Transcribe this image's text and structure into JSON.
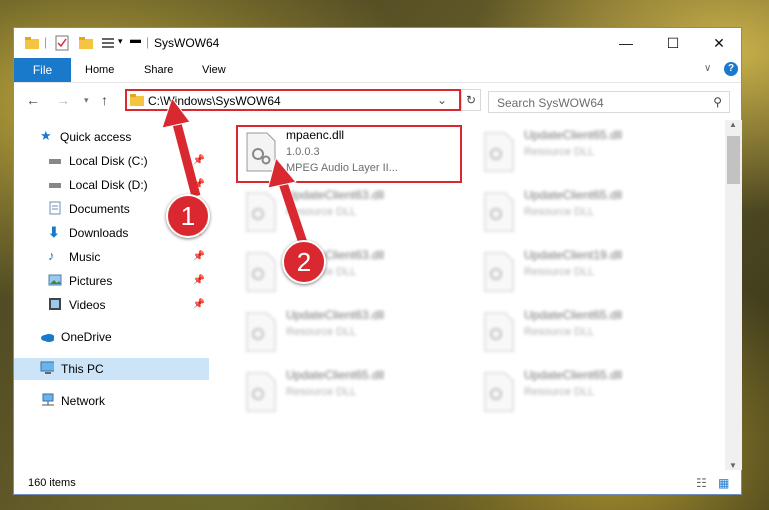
{
  "window": {
    "title": "SysWOW64",
    "minimize": "—",
    "maximize": "☐",
    "close": "✕"
  },
  "ribbon": {
    "tabs": [
      "File",
      "Home",
      "Share",
      "View"
    ]
  },
  "address": {
    "path": "C:\\Windows\\SysWOW64",
    "search_placeholder": "Search SysWOW64"
  },
  "sidebar": {
    "items": [
      {
        "label": "Quick access",
        "icon": "star-icon"
      },
      {
        "label": "Local Disk (C:)",
        "icon": "drive-icon",
        "pinned": true
      },
      {
        "label": "Local Disk (D:)",
        "icon": "drive-icon",
        "pinned": true
      },
      {
        "label": "Documents",
        "icon": "documents-icon",
        "pinned": true
      },
      {
        "label": "Downloads",
        "icon": "download-icon",
        "pinned": true
      },
      {
        "label": "Music",
        "icon": "music-icon",
        "pinned": true
      },
      {
        "label": "Pictures",
        "icon": "pictures-icon",
        "pinned": true
      },
      {
        "label": "Videos",
        "icon": "videos-icon",
        "pinned": true
      },
      {
        "label": "OneDrive",
        "icon": "cloud-icon"
      },
      {
        "label": "This PC",
        "icon": "computer-icon",
        "selected": true
      },
      {
        "label": "Network",
        "icon": "network-icon"
      }
    ]
  },
  "files": {
    "highlighted": {
      "name": "mpaenc.dll",
      "version": "1.0.0.3",
      "description": "MPEG Audio Layer II..."
    },
    "blurred": [
      {
        "name": "UpdateClient65.dll",
        "type": "Resource DLL"
      },
      {
        "name": "UpdateClient63.dll",
        "type": "Resource DLL"
      },
      {
        "name": "UpdateClient65.dll",
        "type": "Resource DLL"
      },
      {
        "name": "UpdateClient63.dll",
        "type": "Resource DLL"
      },
      {
        "name": "UpdateClient19.dll",
        "type": "Resource DLL"
      },
      {
        "name": "UpdateClient63.dll",
        "type": "Resource DLL"
      },
      {
        "name": "UpdateClient65.dll",
        "type": "Resource DLL"
      },
      {
        "name": "UpdateClient65.dll",
        "type": "Resource DLL"
      },
      {
        "name": "UpdateClient65.dll",
        "type": "Resource DLL"
      }
    ]
  },
  "status": {
    "count": "160 items"
  },
  "callouts": {
    "one": "1",
    "two": "2"
  },
  "colors": {
    "accent": "#1979ca",
    "highlight": "#d9282f",
    "selected": "#cce4f7"
  }
}
